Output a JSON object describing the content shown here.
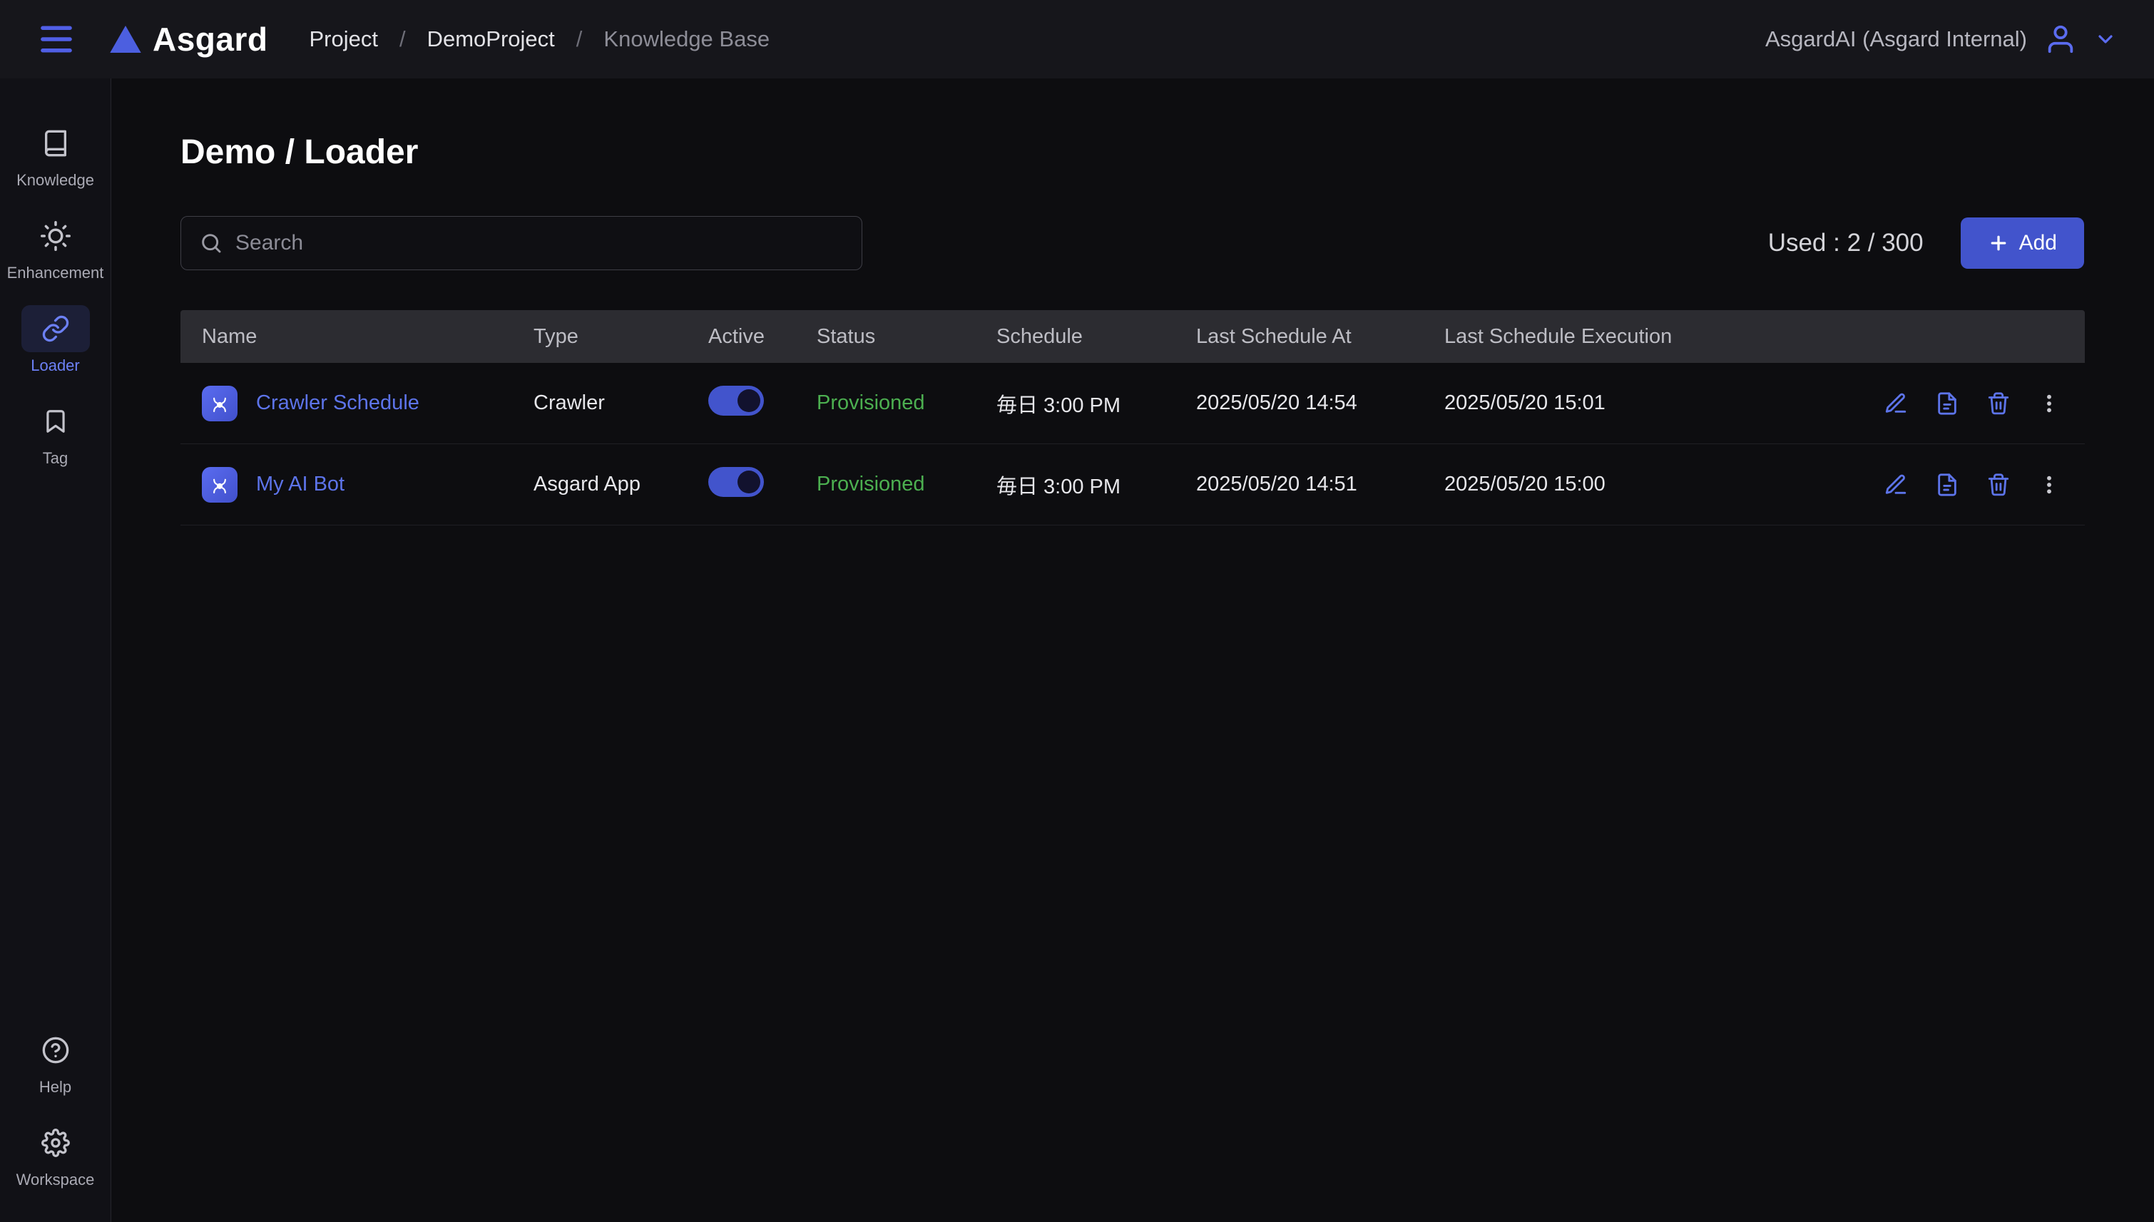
{
  "header": {
    "logo_text": "Asgard",
    "breadcrumb": {
      "separator": "/",
      "items": [
        "Project",
        "DemoProject",
        "Knowledge Base"
      ]
    },
    "account": "AsgardAI (Asgard Internal)"
  },
  "sidebar": {
    "items": [
      {
        "label": "Knowledge",
        "icon": "book-icon",
        "active": false
      },
      {
        "label": "Enhancement",
        "icon": "sun-icon",
        "active": false
      },
      {
        "label": "Loader",
        "icon": "link-icon",
        "active": true
      },
      {
        "label": "Tag",
        "icon": "bookmark-icon",
        "active": false
      }
    ],
    "footer_items": [
      {
        "label": "Help",
        "icon": "help-circle-icon"
      },
      {
        "label": "Workspace",
        "icon": "gear-icon"
      }
    ]
  },
  "main": {
    "title": "Demo / Loader",
    "search_placeholder": "Search",
    "usage": "Used : 2 / 300",
    "add_label": "Add",
    "table": {
      "columns": [
        "Name",
        "Type",
        "Active",
        "Status",
        "Schedule",
        "Last Schedule At",
        "Last Schedule Execution"
      ],
      "rows": [
        {
          "name": "Crawler Schedule",
          "type": "Crawler",
          "active": true,
          "status": "Provisioned",
          "schedule": "毎日 3:00 PM",
          "last_schedule_at": "2025/05/20 14:54",
          "last_schedule_execution": "2025/05/20 15:01"
        },
        {
          "name": "My AI Bot",
          "type": "Asgard App",
          "active": true,
          "status": "Provisioned",
          "schedule": "毎日 3:00 PM",
          "last_schedule_at": "2025/05/20 14:51",
          "last_schedule_execution": "2025/05/20 15:00"
        }
      ]
    }
  },
  "colors": {
    "accent": "#4c5fe0",
    "link": "#5d74ea",
    "toggle_track": "#4254cc",
    "status_provisioned": "#4caf50",
    "header_bg": "#16161b",
    "page_bg": "#0d0d10",
    "table_header_bg": "#2c2c31"
  }
}
